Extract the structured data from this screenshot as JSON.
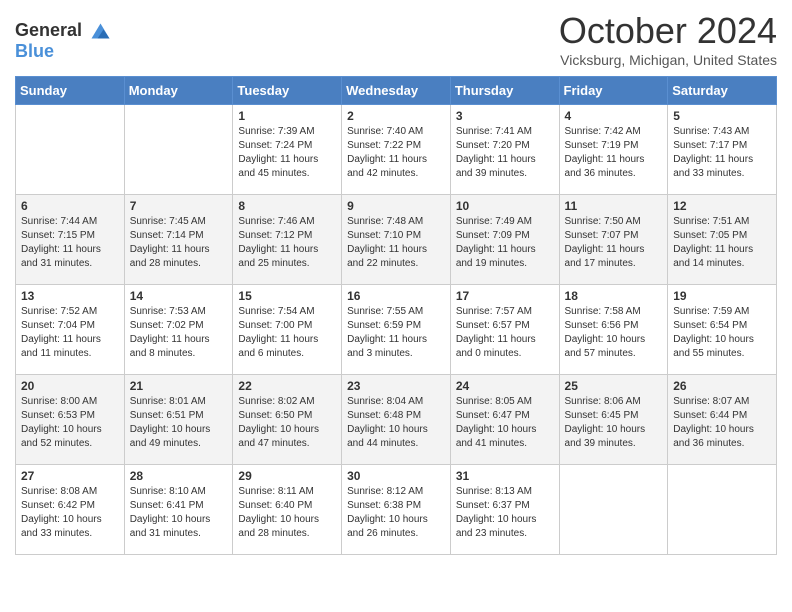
{
  "header": {
    "logo_line1": "General",
    "logo_line2": "Blue",
    "month": "October 2024",
    "location": "Vicksburg, Michigan, United States"
  },
  "days_of_week": [
    "Sunday",
    "Monday",
    "Tuesday",
    "Wednesday",
    "Thursday",
    "Friday",
    "Saturday"
  ],
  "weeks": [
    [
      {
        "day": "",
        "sunrise": "",
        "sunset": "",
        "daylight": ""
      },
      {
        "day": "",
        "sunrise": "",
        "sunset": "",
        "daylight": ""
      },
      {
        "day": "1",
        "sunrise": "Sunrise: 7:39 AM",
        "sunset": "Sunset: 7:24 PM",
        "daylight": "Daylight: 11 hours and 45 minutes."
      },
      {
        "day": "2",
        "sunrise": "Sunrise: 7:40 AM",
        "sunset": "Sunset: 7:22 PM",
        "daylight": "Daylight: 11 hours and 42 minutes."
      },
      {
        "day": "3",
        "sunrise": "Sunrise: 7:41 AM",
        "sunset": "Sunset: 7:20 PM",
        "daylight": "Daylight: 11 hours and 39 minutes."
      },
      {
        "day": "4",
        "sunrise": "Sunrise: 7:42 AM",
        "sunset": "Sunset: 7:19 PM",
        "daylight": "Daylight: 11 hours and 36 minutes."
      },
      {
        "day": "5",
        "sunrise": "Sunrise: 7:43 AM",
        "sunset": "Sunset: 7:17 PM",
        "daylight": "Daylight: 11 hours and 33 minutes."
      }
    ],
    [
      {
        "day": "6",
        "sunrise": "Sunrise: 7:44 AM",
        "sunset": "Sunset: 7:15 PM",
        "daylight": "Daylight: 11 hours and 31 minutes."
      },
      {
        "day": "7",
        "sunrise": "Sunrise: 7:45 AM",
        "sunset": "Sunset: 7:14 PM",
        "daylight": "Daylight: 11 hours and 28 minutes."
      },
      {
        "day": "8",
        "sunrise": "Sunrise: 7:46 AM",
        "sunset": "Sunset: 7:12 PM",
        "daylight": "Daylight: 11 hours and 25 minutes."
      },
      {
        "day": "9",
        "sunrise": "Sunrise: 7:48 AM",
        "sunset": "Sunset: 7:10 PM",
        "daylight": "Daylight: 11 hours and 22 minutes."
      },
      {
        "day": "10",
        "sunrise": "Sunrise: 7:49 AM",
        "sunset": "Sunset: 7:09 PM",
        "daylight": "Daylight: 11 hours and 19 minutes."
      },
      {
        "day": "11",
        "sunrise": "Sunrise: 7:50 AM",
        "sunset": "Sunset: 7:07 PM",
        "daylight": "Daylight: 11 hours and 17 minutes."
      },
      {
        "day": "12",
        "sunrise": "Sunrise: 7:51 AM",
        "sunset": "Sunset: 7:05 PM",
        "daylight": "Daylight: 11 hours and 14 minutes."
      }
    ],
    [
      {
        "day": "13",
        "sunrise": "Sunrise: 7:52 AM",
        "sunset": "Sunset: 7:04 PM",
        "daylight": "Daylight: 11 hours and 11 minutes."
      },
      {
        "day": "14",
        "sunrise": "Sunrise: 7:53 AM",
        "sunset": "Sunset: 7:02 PM",
        "daylight": "Daylight: 11 hours and 8 minutes."
      },
      {
        "day": "15",
        "sunrise": "Sunrise: 7:54 AM",
        "sunset": "Sunset: 7:00 PM",
        "daylight": "Daylight: 11 hours and 6 minutes."
      },
      {
        "day": "16",
        "sunrise": "Sunrise: 7:55 AM",
        "sunset": "Sunset: 6:59 PM",
        "daylight": "Daylight: 11 hours and 3 minutes."
      },
      {
        "day": "17",
        "sunrise": "Sunrise: 7:57 AM",
        "sunset": "Sunset: 6:57 PM",
        "daylight": "Daylight: 11 hours and 0 minutes."
      },
      {
        "day": "18",
        "sunrise": "Sunrise: 7:58 AM",
        "sunset": "Sunset: 6:56 PM",
        "daylight": "Daylight: 10 hours and 57 minutes."
      },
      {
        "day": "19",
        "sunrise": "Sunrise: 7:59 AM",
        "sunset": "Sunset: 6:54 PM",
        "daylight": "Daylight: 10 hours and 55 minutes."
      }
    ],
    [
      {
        "day": "20",
        "sunrise": "Sunrise: 8:00 AM",
        "sunset": "Sunset: 6:53 PM",
        "daylight": "Daylight: 10 hours and 52 minutes."
      },
      {
        "day": "21",
        "sunrise": "Sunrise: 8:01 AM",
        "sunset": "Sunset: 6:51 PM",
        "daylight": "Daylight: 10 hours and 49 minutes."
      },
      {
        "day": "22",
        "sunrise": "Sunrise: 8:02 AM",
        "sunset": "Sunset: 6:50 PM",
        "daylight": "Daylight: 10 hours and 47 minutes."
      },
      {
        "day": "23",
        "sunrise": "Sunrise: 8:04 AM",
        "sunset": "Sunset: 6:48 PM",
        "daylight": "Daylight: 10 hours and 44 minutes."
      },
      {
        "day": "24",
        "sunrise": "Sunrise: 8:05 AM",
        "sunset": "Sunset: 6:47 PM",
        "daylight": "Daylight: 10 hours and 41 minutes."
      },
      {
        "day": "25",
        "sunrise": "Sunrise: 8:06 AM",
        "sunset": "Sunset: 6:45 PM",
        "daylight": "Daylight: 10 hours and 39 minutes."
      },
      {
        "day": "26",
        "sunrise": "Sunrise: 8:07 AM",
        "sunset": "Sunset: 6:44 PM",
        "daylight": "Daylight: 10 hours and 36 minutes."
      }
    ],
    [
      {
        "day": "27",
        "sunrise": "Sunrise: 8:08 AM",
        "sunset": "Sunset: 6:42 PM",
        "daylight": "Daylight: 10 hours and 33 minutes."
      },
      {
        "day": "28",
        "sunrise": "Sunrise: 8:10 AM",
        "sunset": "Sunset: 6:41 PM",
        "daylight": "Daylight: 10 hours and 31 minutes."
      },
      {
        "day": "29",
        "sunrise": "Sunrise: 8:11 AM",
        "sunset": "Sunset: 6:40 PM",
        "daylight": "Daylight: 10 hours and 28 minutes."
      },
      {
        "day": "30",
        "sunrise": "Sunrise: 8:12 AM",
        "sunset": "Sunset: 6:38 PM",
        "daylight": "Daylight: 10 hours and 26 minutes."
      },
      {
        "day": "31",
        "sunrise": "Sunrise: 8:13 AM",
        "sunset": "Sunset: 6:37 PM",
        "daylight": "Daylight: 10 hours and 23 minutes."
      },
      {
        "day": "",
        "sunrise": "",
        "sunset": "",
        "daylight": ""
      },
      {
        "day": "",
        "sunrise": "",
        "sunset": "",
        "daylight": ""
      }
    ]
  ]
}
